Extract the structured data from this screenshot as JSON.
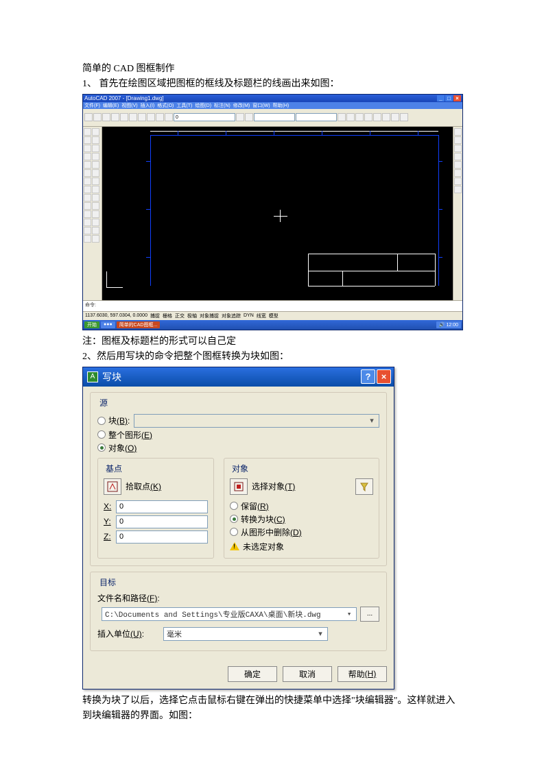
{
  "doc": {
    "title": "简单的 CAD 图框制作",
    "step1": "1、 首先在绘图区域把图框的框线及标题栏的线画出来如图：",
    "note1": "注：图框及标题栏的形式可以自己定",
    "step2": "2、然后用写块的命令把整个图框转换为块如图：",
    "para3": "转换为块了以后，选择它点击鼠标右键在弹出的快捷菜单中选择\"块编辑器\"。这样就进入到块编辑器的界面。如图："
  },
  "cad": {
    "title": "AutoCAD 2007 - [Drawing1.dwg]",
    "menus": [
      "文件(F)",
      "编辑(E)",
      "视图(V)",
      "插入(I)",
      "格式(O)",
      "工具(T)",
      "绘图(D)",
      "标注(N)",
      "修改(M)",
      "窗口(W)",
      "帮助(H)"
    ],
    "layer": "0",
    "cmdprompt": "命令:",
    "coords": "1137.6030, 597.0304, 0.0000",
    "status": [
      "捕捉",
      "栅格",
      "正交",
      "极轴",
      "对象捕捉",
      "对象追踪",
      "DYN",
      "线宽",
      "模型"
    ],
    "taskbar_start": "开始",
    "taskbar_items": [
      "简单的CAD图框..."
    ]
  },
  "dialog": {
    "title": "写块",
    "source": {
      "legend": "源",
      "opt_block": "块",
      "opt_block_key": "(B)",
      "opt_entire": "整个图形",
      "opt_entire_key": "(E)",
      "opt_objects": "对象",
      "opt_objects_key": "(O)"
    },
    "base": {
      "legend": "基点",
      "pick": "拾取点",
      "pick_key": "(K)",
      "x_lbl": "X:",
      "x_val": "0",
      "y_lbl": "Y:",
      "y_val": "0",
      "z_lbl": "Z:",
      "z_val": "0"
    },
    "objects": {
      "legend": "对象",
      "select": "选择对象",
      "select_key": "(T)",
      "opt_retain": "保留",
      "opt_retain_key": "(R)",
      "opt_convert": "转换为块",
      "opt_convert_key": "(C)",
      "opt_delete": "从图形中删除",
      "opt_delete_key": "(D)",
      "warn": "未选定对象"
    },
    "dest": {
      "legend": "目标",
      "path_lbl": "文件名和路径",
      "path_key": "(F)",
      "path_val": "C:\\Documents and Settings\\专业版CAXA\\桌面\\新块.dwg",
      "unit_lbl": "插入单位",
      "unit_key": "(U)",
      "unit_val": "毫米"
    },
    "buttons": {
      "ok": "确定",
      "cancel": "取消",
      "help": "帮助",
      "help_key": "(H)"
    }
  }
}
